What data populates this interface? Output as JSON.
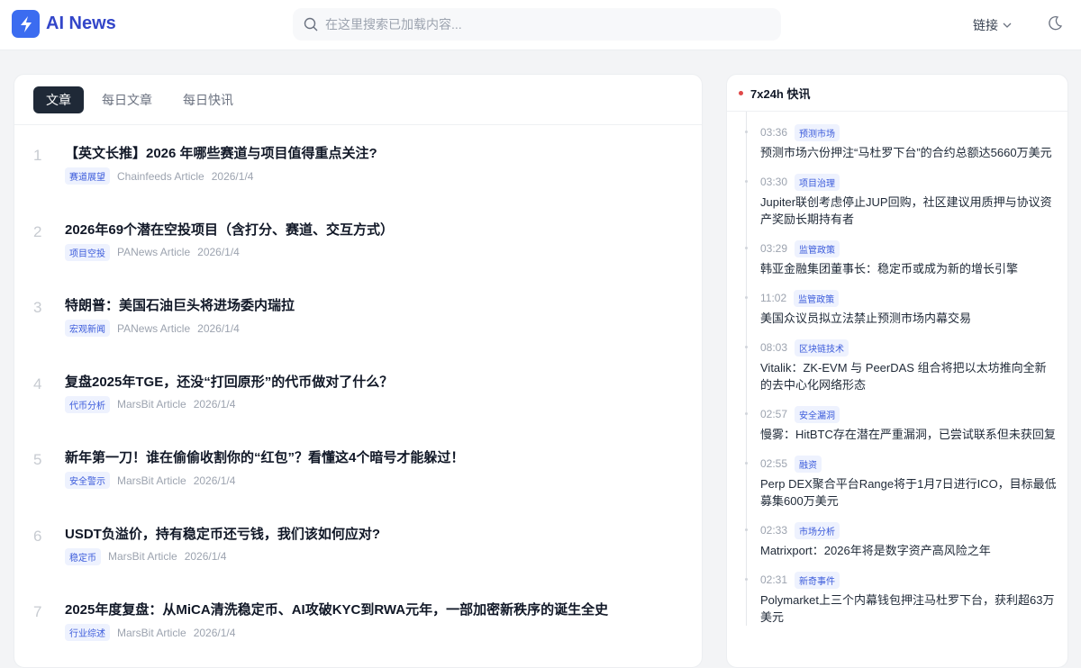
{
  "header": {
    "brand": "AI News",
    "search_placeholder": "在这里搜索已加载内容...",
    "links_label": "链接"
  },
  "tabs": [
    "文章",
    "每日文章",
    "每日快讯"
  ],
  "articles": [
    {
      "n": "1",
      "title": "【英文长推】2026 年哪些赛道与项目值得重点关注?",
      "tag": "赛道展望",
      "source": "Chainfeeds Article",
      "date": "2026/1/4"
    },
    {
      "n": "2",
      "title": "2026年69个潜在空投项目（含打分、赛道、交互方式）",
      "tag": "项目空投",
      "source": "PANews Article",
      "date": "2026/1/4"
    },
    {
      "n": "3",
      "title": "特朗普：美国石油巨头将进场委内瑞拉",
      "tag": "宏观新闻",
      "source": "PANews Article",
      "date": "2026/1/4"
    },
    {
      "n": "4",
      "title": "复盘2025年TGE，还没“打回原形”的代币做对了什么？",
      "tag": "代币分析",
      "source": "MarsBit Article",
      "date": "2026/1/4"
    },
    {
      "n": "5",
      "title": "新年第一刀！谁在偷偷收割你的“红包”？看懂这4个暗号才能躲过！",
      "tag": "安全警示",
      "source": "MarsBit Article",
      "date": "2026/1/4"
    },
    {
      "n": "6",
      "title": "USDT负溢价，持有稳定币还亏钱，我们该如何应对?",
      "tag": "稳定币",
      "source": "MarsBit Article",
      "date": "2026/1/4"
    },
    {
      "n": "7",
      "title": "2025年度复盘：从MiCA清洗稳定币、AI攻破KYC到RWA元年，一部加密新秩序的诞生全史",
      "tag": "行业综述",
      "source": "MarsBit Article",
      "date": "2026/1/4"
    }
  ],
  "flash": {
    "title": "7x24h 快讯",
    "items": [
      {
        "time": "03:36",
        "tag": "预测市场",
        "text": "预测市场六份押注“马杜罗下台”的合约总额达5660万美元"
      },
      {
        "time": "03:30",
        "tag": "项目治理",
        "text": "Jupiter联创考虑停止JUP回购，社区建议用质押与协议资产奖励长期持有者"
      },
      {
        "time": "03:29",
        "tag": "监管政策",
        "text": "韩亚金融集团董事长：稳定币或成为新的增长引擎"
      },
      {
        "time": "11:02",
        "tag": "监管政策",
        "text": "美国众议员拟立法禁止预测市场内幕交易"
      },
      {
        "time": "08:03",
        "tag": "区块链技术",
        "text": "Vitalik：ZK-EVM 与 PeerDAS 组合将把以太坊推向全新的去中心化网络形态"
      },
      {
        "time": "02:57",
        "tag": "安全漏洞",
        "text": "慢雾：HitBTC存在潜在严重漏洞，已尝试联系但未获回复"
      },
      {
        "time": "02:55",
        "tag": "融资",
        "text": "Perp DEX聚合平台Range将于1月7日进行ICO，目标最低募集600万美元"
      },
      {
        "time": "02:33",
        "tag": "市场分析",
        "text": "Matrixport：2026年将是数字资产高风险之年"
      },
      {
        "time": "02:31",
        "tag": "新奇事件",
        "text": "Polymarket上三个内幕钱包押注马杜罗下台，获利超63万美元"
      }
    ]
  }
}
